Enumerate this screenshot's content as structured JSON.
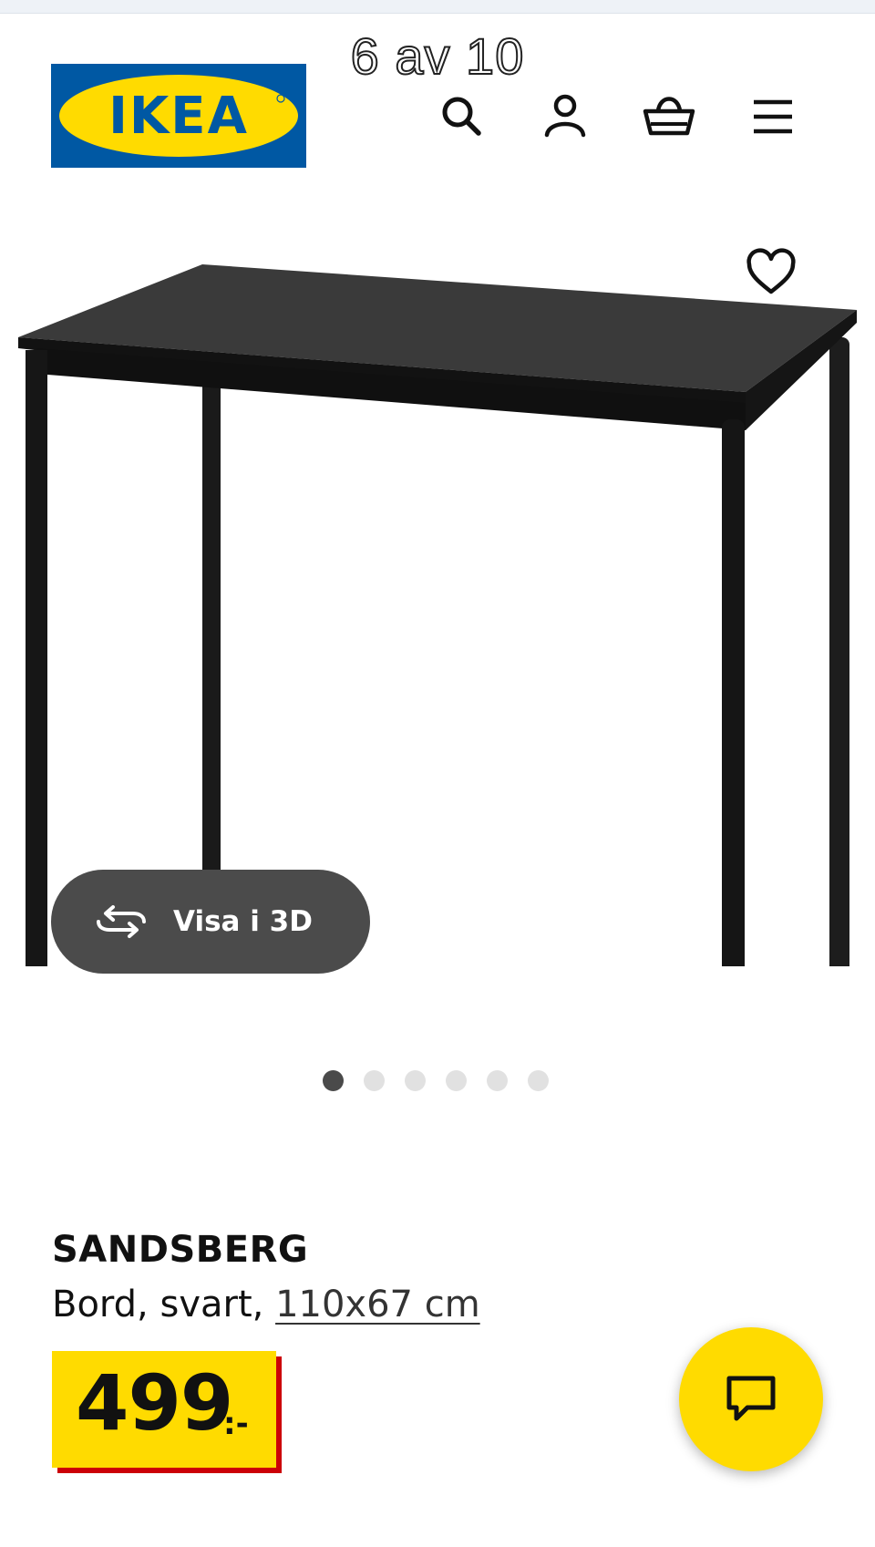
{
  "image_counter": "6 av 10",
  "brand": {
    "logo_text": "IKEA",
    "colors": {
      "blue": "#0058a3",
      "yellow": "#ffdb00"
    }
  },
  "header": {
    "icons": [
      "search-icon",
      "account-icon",
      "basket-icon",
      "menu-icon"
    ]
  },
  "gallery": {
    "view_3d_label": "Visa i 3D",
    "dot_count": 6,
    "active_dot": 0
  },
  "product": {
    "name": "SANDSBERG",
    "description_prefix": "Bord, svart, ",
    "dimensions": "110x67 cm",
    "price": "499",
    "currency_suffix": ":-",
    "price_colors": {
      "box": "#ffdb00",
      "shadow": "#cc0008"
    }
  },
  "chat": {
    "icon": "chat-icon",
    "color": "#ffdb00"
  }
}
